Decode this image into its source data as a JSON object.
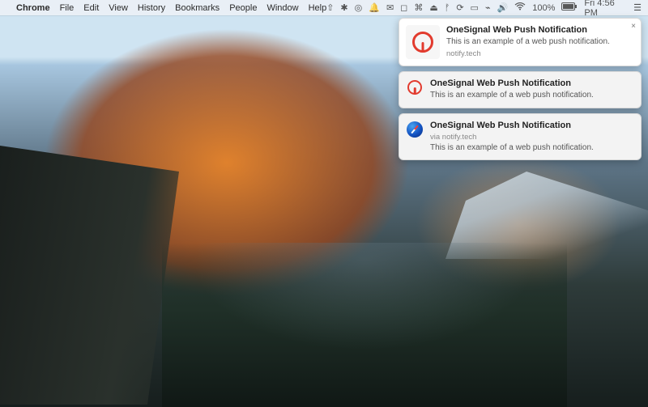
{
  "menubar": {
    "apple": "",
    "app": "Chrome",
    "items": [
      "File",
      "Edit",
      "View",
      "History",
      "Bookmarks",
      "People",
      "Window",
      "Help"
    ],
    "status": {
      "icons": [
        "⇧",
        "✱",
        "◎",
        "🔔",
        "✉",
        "◻",
        "⌘",
        "⏏",
        "ᚠ",
        "⟳",
        "▭",
        "⌁",
        "🔊"
      ],
      "wifi": "100%",
      "battery": "▮▮",
      "clock": "Fri 4:56 PM"
    }
  },
  "notifications": [
    {
      "style": "big",
      "iconType": "onesignal",
      "title": "OneSignal Web Push Notification",
      "message": "This is an example of a web push notification.",
      "source": "notify.tech",
      "closable": true
    },
    {
      "style": "small",
      "iconType": "onesignal",
      "title": "OneSignal Web Push Notification",
      "message": "This is an example of a web push notification."
    },
    {
      "style": "small",
      "iconType": "safari",
      "title": "OneSignal Web Push Notification",
      "via": "via notify.tech",
      "message": "This is an example of a web push notification."
    }
  ]
}
